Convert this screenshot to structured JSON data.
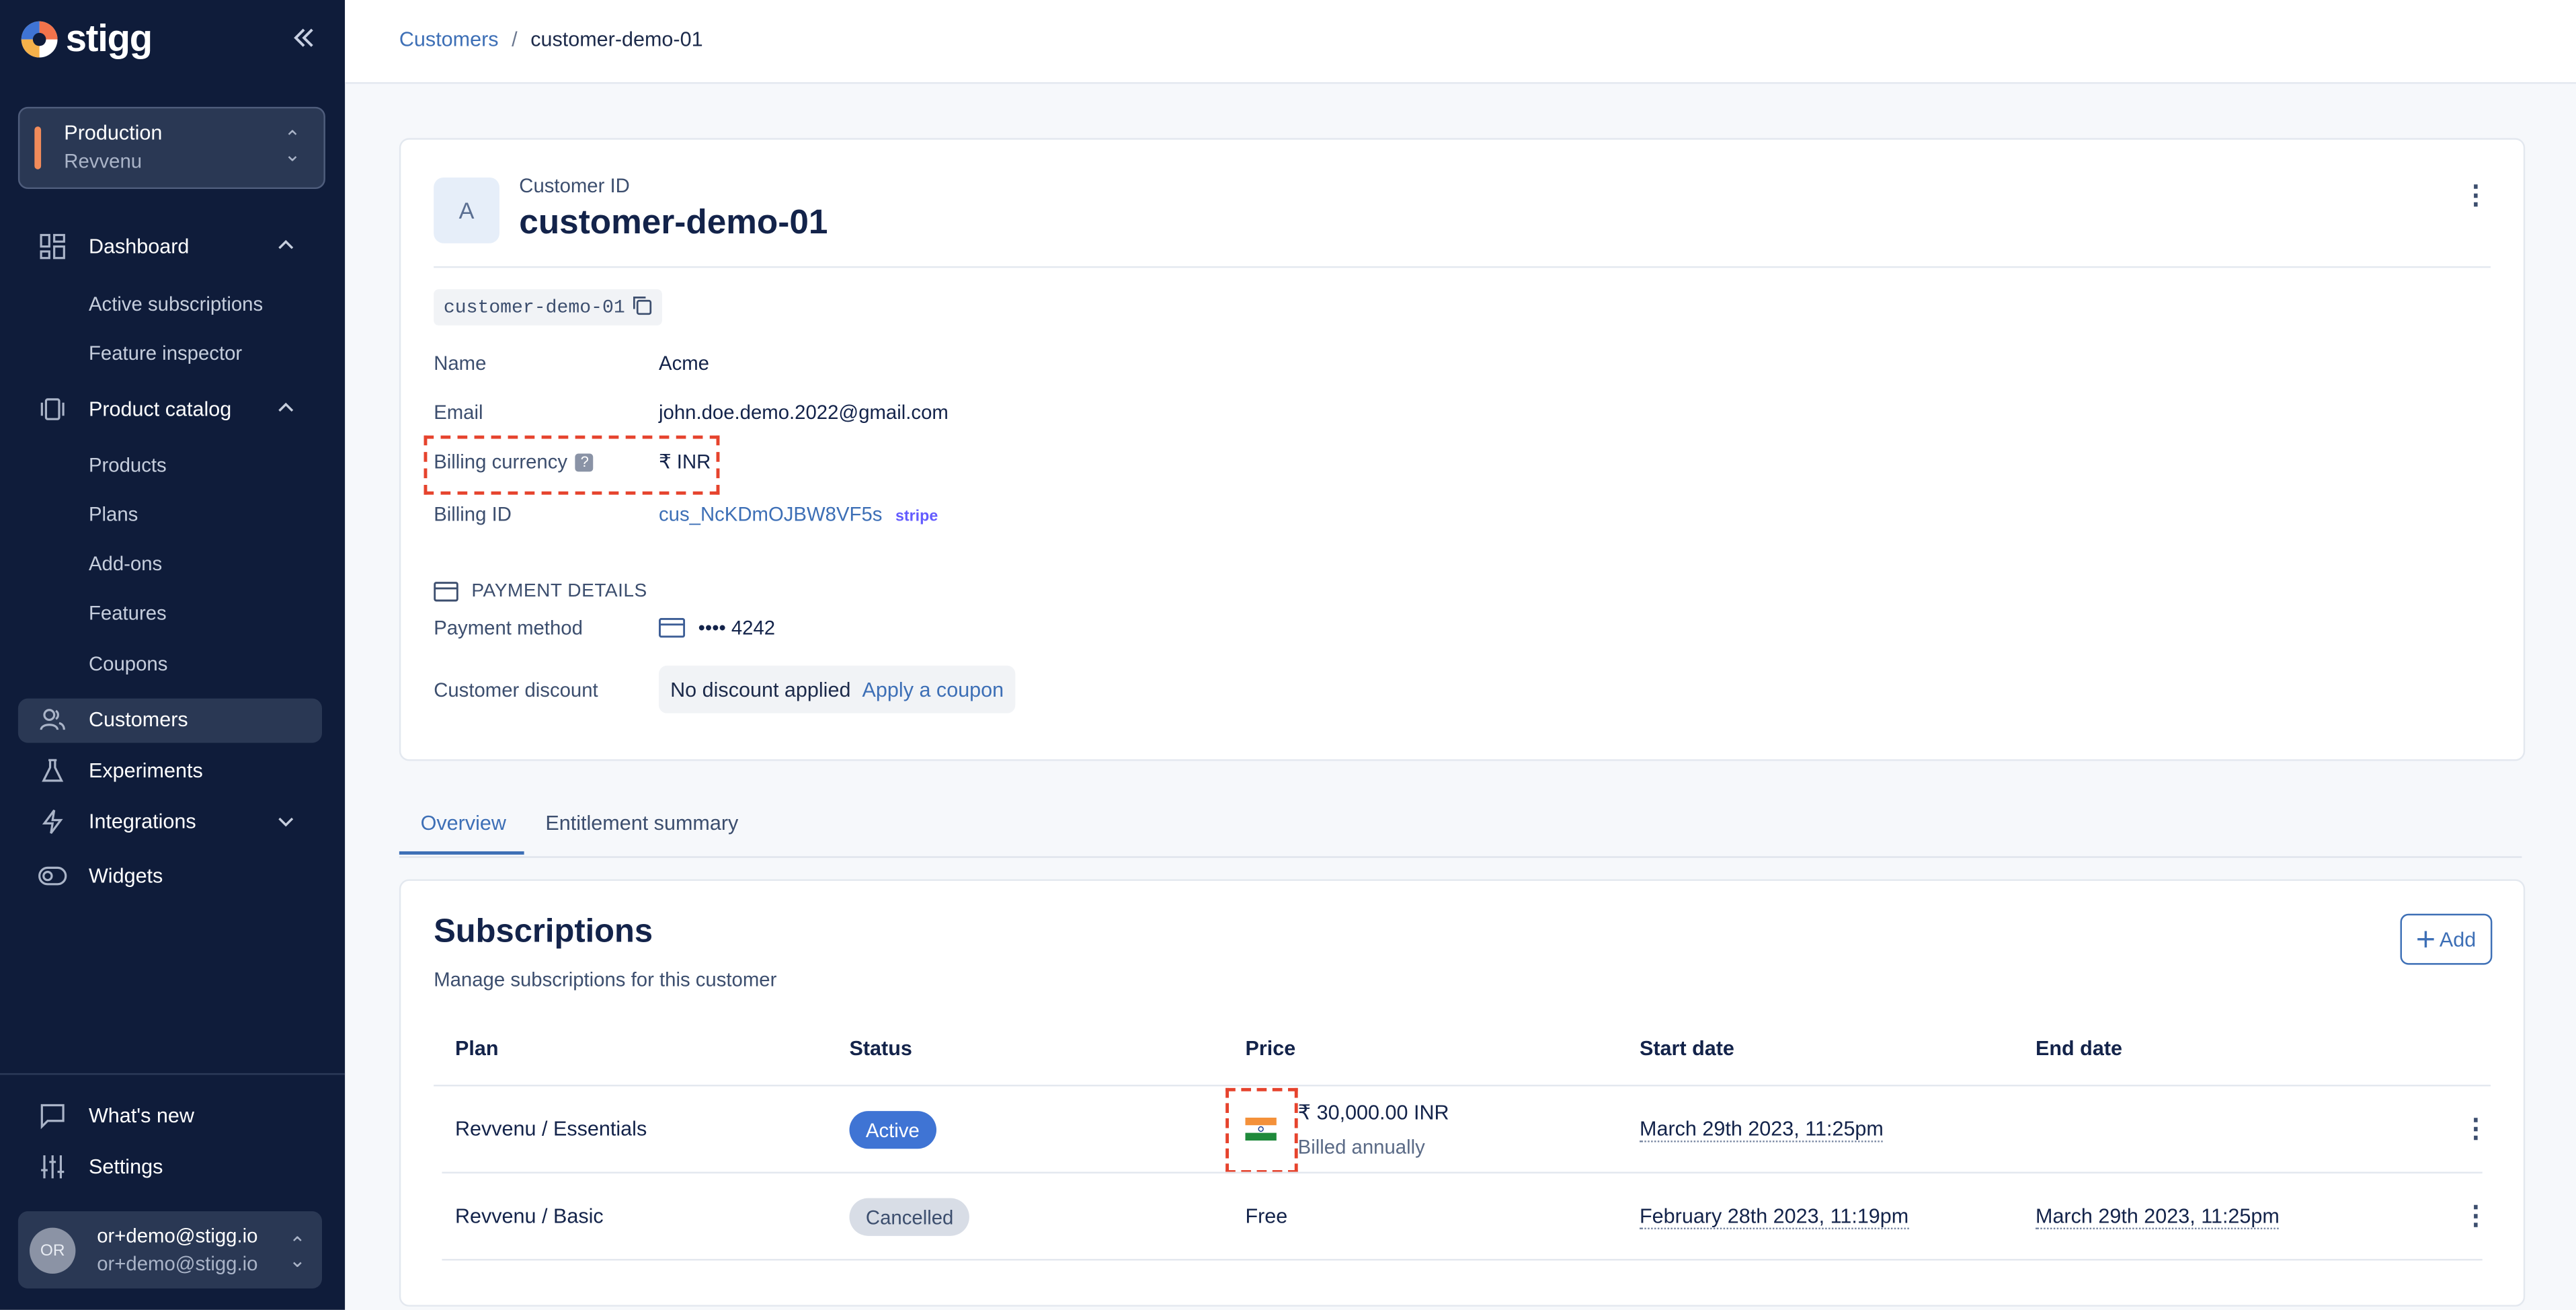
{
  "brand": {
    "name": "stigg"
  },
  "environment": {
    "title": "Production",
    "subtitle": "Revvenu"
  },
  "sidebar": {
    "dashboard": "Dashboard",
    "active_subscriptions": "Active subscriptions",
    "feature_inspector": "Feature inspector",
    "product_catalog": "Product catalog",
    "products": "Products",
    "plans": "Plans",
    "addons": "Add-ons",
    "features": "Features",
    "coupons": "Coupons",
    "customers": "Customers",
    "experiments": "Experiments",
    "integrations": "Integrations",
    "widgets": "Widgets",
    "whats_new": "What's new",
    "settings": "Settings"
  },
  "user": {
    "initials": "OR",
    "name": "or+demo@stigg.io",
    "email": "or+demo@stigg.io"
  },
  "breadcrumb": {
    "parent": "Customers",
    "separator": "/",
    "current": "customer-demo-01"
  },
  "customer": {
    "avatar_letter": "A",
    "id_label": "Customer ID",
    "id": "customer-demo-01",
    "code": "customer-demo-01",
    "name_label": "Name",
    "name": "Acme",
    "email_label": "Email",
    "email": "john.doe.demo.2022@gmail.com",
    "currency_label": "Billing currency",
    "currency_help": "?",
    "currency": "₹ INR",
    "billing_id_label": "Billing ID",
    "billing_id": "cus_NcKDmOJBW8VF5s",
    "billing_provider": "stripe",
    "payment_details_heading": "PAYMENT DETAILS",
    "payment_method_label": "Payment method",
    "payment_method": "•••• 4242",
    "discount_label": "Customer discount",
    "discount_value": "No discount applied",
    "apply_coupon": "Apply a coupon"
  },
  "tabs": [
    {
      "label": "Overview",
      "active": true
    },
    {
      "label": "Entitlement summary",
      "active": false
    }
  ],
  "subscriptions": {
    "title": "Subscriptions",
    "description": "Manage subscriptions for this customer",
    "add_label": "Add",
    "columns": [
      "Plan",
      "Status",
      "Price",
      "Start date",
      "End date"
    ],
    "rows": [
      {
        "plan": "Revvenu / Essentials",
        "status": "Active",
        "price": "₹ 30,000.00 INR",
        "billing": "Billed annually",
        "start": "March 29th 2023, 11:25pm",
        "end": ""
      },
      {
        "plan": "Revvenu / Basic",
        "status": "Cancelled",
        "price": "Free",
        "billing": "",
        "start": "February 28th 2023, 11:19pm",
        "end": "March 29th 2023, 11:25pm"
      }
    ]
  },
  "colors": {
    "sidebar_bg": "#0f1c3a",
    "accent": "#3d6fb6",
    "highlight": "#e6432d",
    "env_bar": "#f28b5a"
  }
}
